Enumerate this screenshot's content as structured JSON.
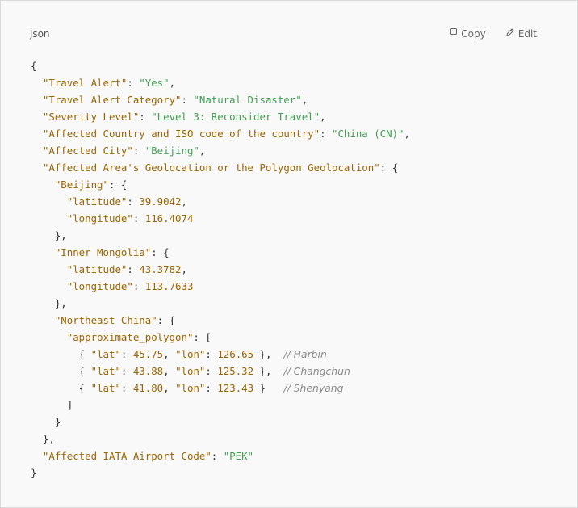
{
  "header": {
    "language": "json",
    "copy_label": "Copy",
    "edit_label": "Edit",
    "copy_icon": "copy-icon",
    "edit_icon": "edit-icon"
  },
  "colors": {
    "key": "#9c6500",
    "string": "#3f9f4f",
    "number": "#9c6500",
    "comment": "#8a8a8a",
    "background": "#f9f9f9"
  },
  "code": {
    "lines": [
      [
        {
          "t": "p",
          "v": "{"
        }
      ],
      [
        {
          "t": "p",
          "v": "  "
        },
        {
          "t": "k",
          "v": "\"Travel Alert\""
        },
        {
          "t": "p",
          "v": ": "
        },
        {
          "t": "s",
          "v": "\"Yes\""
        },
        {
          "t": "p",
          "v": ","
        }
      ],
      [
        {
          "t": "p",
          "v": "  "
        },
        {
          "t": "k",
          "v": "\"Travel Alert Category\""
        },
        {
          "t": "p",
          "v": ": "
        },
        {
          "t": "s",
          "v": "\"Natural Disaster\""
        },
        {
          "t": "p",
          "v": ","
        }
      ],
      [
        {
          "t": "p",
          "v": "  "
        },
        {
          "t": "k",
          "v": "\"Severity Level\""
        },
        {
          "t": "p",
          "v": ": "
        },
        {
          "t": "s",
          "v": "\"Level 3: Reconsider Travel\""
        },
        {
          "t": "p",
          "v": ","
        }
      ],
      [
        {
          "t": "p",
          "v": "  "
        },
        {
          "t": "k",
          "v": "\"Affected Country and ISO code of the country\""
        },
        {
          "t": "p",
          "v": ": "
        },
        {
          "t": "s",
          "v": "\"China (CN)\""
        },
        {
          "t": "p",
          "v": ","
        }
      ],
      [
        {
          "t": "p",
          "v": "  "
        },
        {
          "t": "k",
          "v": "\"Affected City\""
        },
        {
          "t": "p",
          "v": ": "
        },
        {
          "t": "s",
          "v": "\"Beijing\""
        },
        {
          "t": "p",
          "v": ","
        }
      ],
      [
        {
          "t": "p",
          "v": "  "
        },
        {
          "t": "k",
          "v": "\"Affected Area's Geolocation or the Polygon Geolocation\""
        },
        {
          "t": "p",
          "v": ": {"
        }
      ],
      [
        {
          "t": "p",
          "v": "    "
        },
        {
          "t": "k",
          "v": "\"Beijing\""
        },
        {
          "t": "p",
          "v": ": {"
        }
      ],
      [
        {
          "t": "p",
          "v": "      "
        },
        {
          "t": "k",
          "v": "\"latitude\""
        },
        {
          "t": "p",
          "v": ": "
        },
        {
          "t": "n",
          "v": "39.9042"
        },
        {
          "t": "p",
          "v": ","
        }
      ],
      [
        {
          "t": "p",
          "v": "      "
        },
        {
          "t": "k",
          "v": "\"longitude\""
        },
        {
          "t": "p",
          "v": ": "
        },
        {
          "t": "n",
          "v": "116.4074"
        }
      ],
      [
        {
          "t": "p",
          "v": "    },"
        }
      ],
      [
        {
          "t": "p",
          "v": "    "
        },
        {
          "t": "k",
          "v": "\"Inner Mongolia\""
        },
        {
          "t": "p",
          "v": ": {"
        }
      ],
      [
        {
          "t": "p",
          "v": "      "
        },
        {
          "t": "k",
          "v": "\"latitude\""
        },
        {
          "t": "p",
          "v": ": "
        },
        {
          "t": "n",
          "v": "43.3782"
        },
        {
          "t": "p",
          "v": ","
        }
      ],
      [
        {
          "t": "p",
          "v": "      "
        },
        {
          "t": "k",
          "v": "\"longitude\""
        },
        {
          "t": "p",
          "v": ": "
        },
        {
          "t": "n",
          "v": "113.7633"
        }
      ],
      [
        {
          "t": "p",
          "v": "    },"
        }
      ],
      [
        {
          "t": "p",
          "v": "    "
        },
        {
          "t": "k",
          "v": "\"Northeast China\""
        },
        {
          "t": "p",
          "v": ": {"
        }
      ],
      [
        {
          "t": "p",
          "v": "      "
        },
        {
          "t": "k",
          "v": "\"approximate_polygon\""
        },
        {
          "t": "p",
          "v": ": ["
        }
      ],
      [
        {
          "t": "p",
          "v": "        { "
        },
        {
          "t": "k",
          "v": "\"lat\""
        },
        {
          "t": "p",
          "v": ": "
        },
        {
          "t": "n",
          "v": "45.75"
        },
        {
          "t": "p",
          "v": ", "
        },
        {
          "t": "k",
          "v": "\"lon\""
        },
        {
          "t": "p",
          "v": ": "
        },
        {
          "t": "n",
          "v": "126.65"
        },
        {
          "t": "p",
          "v": " },  "
        },
        {
          "t": "c",
          "v": "// Harbin"
        }
      ],
      [
        {
          "t": "p",
          "v": "        { "
        },
        {
          "t": "k",
          "v": "\"lat\""
        },
        {
          "t": "p",
          "v": ": "
        },
        {
          "t": "n",
          "v": "43.88"
        },
        {
          "t": "p",
          "v": ", "
        },
        {
          "t": "k",
          "v": "\"lon\""
        },
        {
          "t": "p",
          "v": ": "
        },
        {
          "t": "n",
          "v": "125.32"
        },
        {
          "t": "p",
          "v": " },  "
        },
        {
          "t": "c",
          "v": "// Changchun"
        }
      ],
      [
        {
          "t": "p",
          "v": "        { "
        },
        {
          "t": "k",
          "v": "\"lat\""
        },
        {
          "t": "p",
          "v": ": "
        },
        {
          "t": "n",
          "v": "41.80"
        },
        {
          "t": "p",
          "v": ", "
        },
        {
          "t": "k",
          "v": "\"lon\""
        },
        {
          "t": "p",
          "v": ": "
        },
        {
          "t": "n",
          "v": "123.43"
        },
        {
          "t": "p",
          "v": " }   "
        },
        {
          "t": "c",
          "v": "// Shenyang"
        }
      ],
      [
        {
          "t": "p",
          "v": "      ]"
        }
      ],
      [
        {
          "t": "p",
          "v": "    }"
        }
      ],
      [
        {
          "t": "p",
          "v": "  },"
        }
      ],
      [
        {
          "t": "p",
          "v": "  "
        },
        {
          "t": "k",
          "v": "\"Affected IATA Airport Code\""
        },
        {
          "t": "p",
          "v": ": "
        },
        {
          "t": "s",
          "v": "\"PEK\""
        }
      ],
      [
        {
          "t": "p",
          "v": "}"
        }
      ]
    ]
  }
}
